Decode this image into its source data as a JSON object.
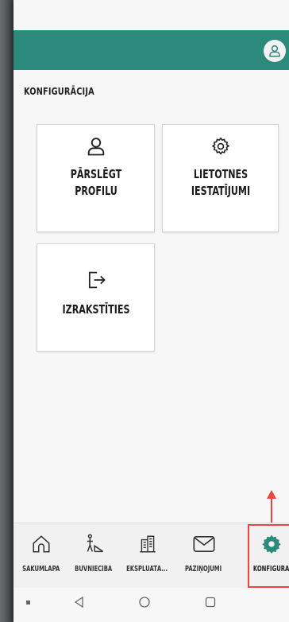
{
  "header": {
    "avatar_icon": "user-icon",
    "accent_color": "#2b8a7c"
  },
  "page": {
    "title": "KONFIGURĀCIJA"
  },
  "tiles": [
    {
      "label_line1": "PĀRSLĒGT",
      "label_line2": "PROFILU",
      "icon": "user-icon"
    },
    {
      "label_line1": "LIETOTNES",
      "label_line2": "IESTATĪJUMI",
      "icon": "gear-icon"
    },
    {
      "label_line1": "IZRAKSTĪTIES",
      "label_line2": "",
      "icon": "logout-icon"
    }
  ],
  "bottom_nav": {
    "items": [
      {
        "label": "SĀKUMLAPA",
        "icon": "home-icon"
      },
      {
        "label": "BŪVNIECĪBA",
        "icon": "construction-icon"
      },
      {
        "label": "EKSPLUATĀ...",
        "icon": "building-icon"
      },
      {
        "label": "PAZIŅOJUMI",
        "icon": "envelope-icon"
      },
      {
        "label": "KONFIGURĀ",
        "icon": "gear-icon",
        "active": true
      }
    ],
    "active_color": "#2b8a7c"
  },
  "annotation": {
    "color": "#e8473f"
  }
}
